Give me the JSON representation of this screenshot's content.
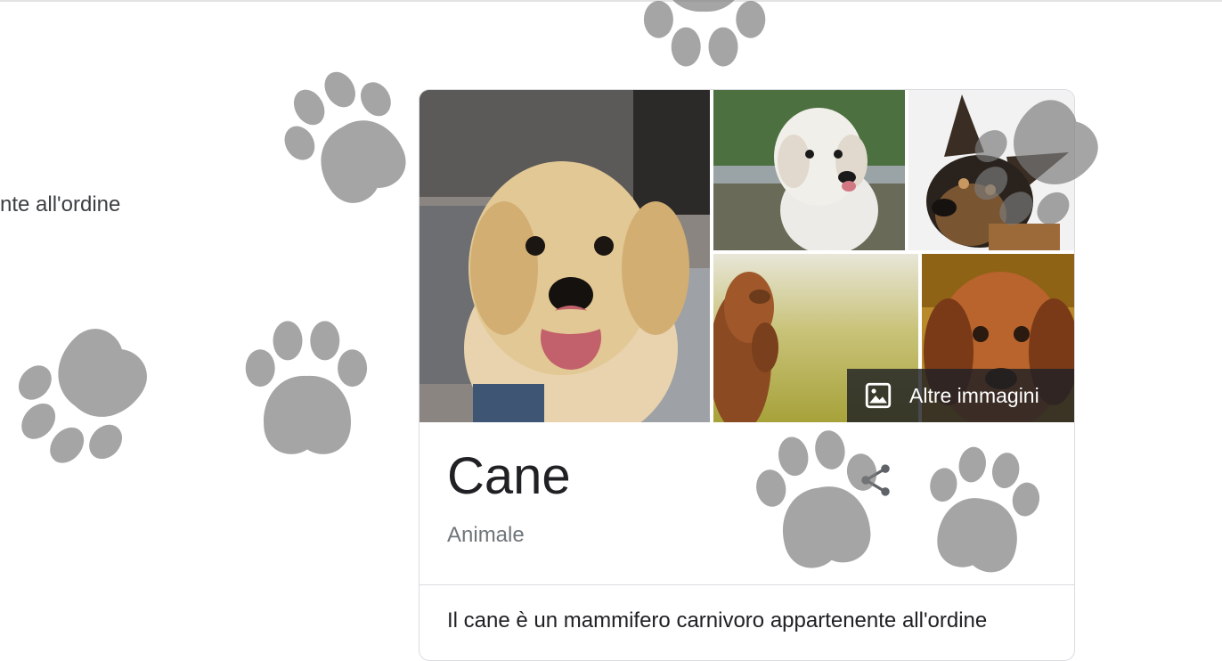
{
  "left_snippet": "nte all'ordine",
  "knowledge_panel": {
    "images": [
      {
        "name": "golden-retriever-puppy",
        "alt": "Golden retriever puppy"
      },
      {
        "name": "white-poodle-mix",
        "alt": "White fluffy dog"
      },
      {
        "name": "german-shepherd",
        "alt": "German shepherd"
      },
      {
        "name": "vizsla-dog",
        "alt": "Vizsla"
      },
      {
        "name": "brown-puppy",
        "alt": "Brown puppy"
      }
    ],
    "more_images_label": "Altre immagini",
    "more_images_icon": "image-icon",
    "title": "Cane",
    "subtitle": "Animale",
    "share_icon": "share-icon",
    "description_partial": "Il cane è un mammifero carnivoro appartenente all'ordine"
  },
  "colors": {
    "title": "#202124",
    "subtitle": "#70757a",
    "border": "#dadce0",
    "overlay": "#202124",
    "paw": "#787878"
  }
}
